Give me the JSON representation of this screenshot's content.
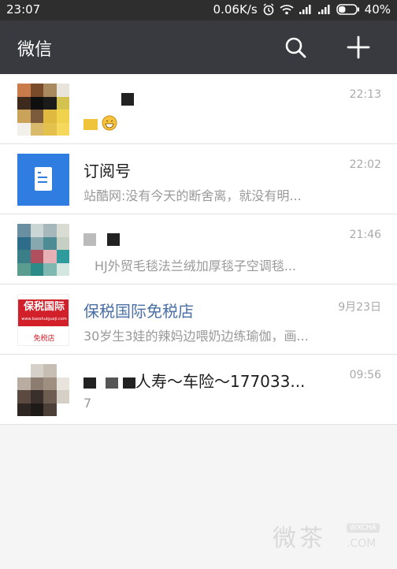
{
  "status_bar": {
    "time": "23:07",
    "net_speed": "0.06K/s",
    "battery_percent": "40%",
    "battery_level": 0.4,
    "icons": [
      "alarm-icon",
      "wifi-icon",
      "signal-icon",
      "signal-icon",
      "battery-icon"
    ]
  },
  "header": {
    "title": "微信",
    "search_icon": "search-icon",
    "add_icon": "plus-icon"
  },
  "chats": [
    {
      "name": "",
      "message": "",
      "time": "22:13",
      "avatar": "mosaic-avatar"
    },
    {
      "name": "订阅号",
      "message": "站酷网:没有今天的断舍离，就没有明...",
      "time": "22:02",
      "avatar": "subscription-avatar"
    },
    {
      "name": "",
      "message": "HJ外贸毛毯法兰绒加厚毯子空调毯...",
      "time": "21:46",
      "avatar": "mosaic-avatar"
    },
    {
      "name": "保税国际免税店",
      "message": "30岁生3娃的辣妈边喂奶边练瑜伽，画...",
      "time": "9月23日",
      "avatar": "shop-avatar"
    },
    {
      "name": "人寿～车险～177033...",
      "message": "7",
      "time": "09:56",
      "avatar": "mosaic-avatar"
    }
  ],
  "shop_logo": {
    "title": "保税国际",
    "url": "www.baoshuiguoji.com",
    "sub": "免税店"
  },
  "watermark": {
    "text": "微茶",
    "badge": "WXCHA",
    "url": ".COM"
  },
  "colors": {
    "status_bar": "#2e2e2e",
    "title_bar": "#393a3f",
    "service_name": "#4a6fa5",
    "subscription_blue": "#2f7de1",
    "shop_red": "#d2202a"
  }
}
